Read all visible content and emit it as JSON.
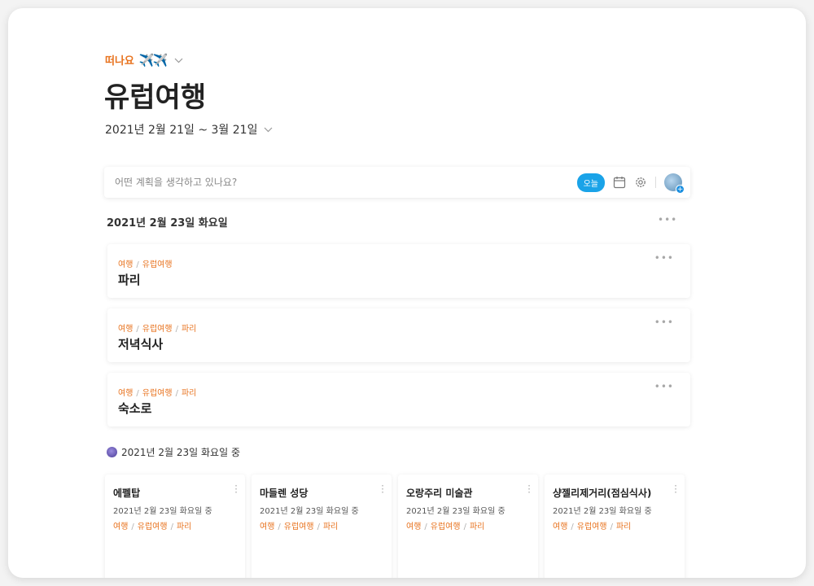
{
  "workspace": {
    "name": "떠나요",
    "emoji": "✈️✈️"
  },
  "page_title": "유럽여행",
  "date_range": "2021년 2월 21일 ~ 3월 21일",
  "input_bar": {
    "placeholder": "어떤 계획을 생각하고 있나요?",
    "today_label": "오늘"
  },
  "day_header": "2021년 2월 23일 화요일",
  "day_cards": [
    {
      "crumbs": [
        "여행",
        "유럽여행"
      ],
      "title": "파리"
    },
    {
      "crumbs": [
        "여행",
        "유럽여행",
        "파리"
      ],
      "title": "저녁식사"
    },
    {
      "crumbs": [
        "여행",
        "유럽여행",
        "파리"
      ],
      "title": "숙소로"
    }
  ],
  "ongoing_header": "2021년 2월 23일 화요일 중",
  "ongoing_cards": [
    {
      "title": "에펠탑",
      "date": "2021년 2월 23일 화요일 중",
      "crumbs": [
        "여행",
        "유럽여행",
        "파리"
      ]
    },
    {
      "title": "마들렌 성당",
      "date": "2021년 2월 23일 화요일 중",
      "crumbs": [
        "여행",
        "유럽여행",
        "파리"
      ]
    },
    {
      "title": "오랑주리 미술관",
      "date": "2021년 2월 23일 화요일 중",
      "crumbs": [
        "여행",
        "유럽여행",
        "파리"
      ]
    },
    {
      "title": "샹젤리제거리(점심식사)",
      "date": "2021년 2월 23일 화요일 중",
      "crumbs": [
        "여행",
        "유럽여행",
        "파리"
      ]
    }
  ],
  "colors": {
    "accent_orange": "#e8731f",
    "today_blue": "#1aa3e8"
  },
  "icons": {
    "workspace_dropdown": "chevron-down-icon",
    "date_dropdown": "chevron-down-icon",
    "calendar": "calendar-icon",
    "settings": "gear-icon",
    "more": "more-horizontal-icon",
    "card_more": "more-vertical-icon",
    "ongoing": "ongoing-icon"
  }
}
